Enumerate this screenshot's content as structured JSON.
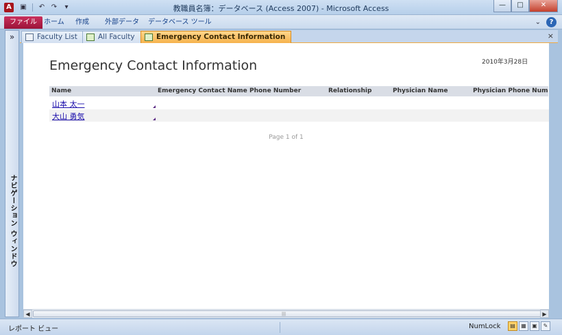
{
  "window": {
    "title": "教職員名簿：データベース (Access 2007) - Microsoft Access",
    "app_icon_letter": "A",
    "minimize": "—",
    "maximize": "□",
    "close": "✕"
  },
  "qat": {
    "save_icon": "▣",
    "undo_icon": "↶",
    "redo_icon": "↷",
    "customize_icon": "▾"
  },
  "ribbon": {
    "tabs": [
      "ファイル",
      "ホーム",
      "作成",
      "外部データ",
      "データベース ツール"
    ],
    "collapse_icon": "⌄",
    "help": "?"
  },
  "nav": {
    "toggle": "»",
    "label": "ナビゲーション ウィンドウ"
  },
  "doc_tabs": [
    {
      "label": "Faculty List"
    },
    {
      "label": "All Faculty"
    },
    {
      "label": "Emergency Contact Information"
    }
  ],
  "doc_close": "×",
  "report": {
    "date": "2010年3月28日",
    "title": "Emergency Contact Information",
    "columns": [
      "Name",
      "Emergency Contact Name",
      "Phone Number",
      "Relationship",
      "Physician Name",
      "Physician Phone Number"
    ],
    "rows": [
      {
        "name": "山本 太一"
      },
      {
        "name": "大山 勇気"
      }
    ],
    "page": "Page 1 of 1"
  },
  "scrollbar": {
    "left": "◀",
    "right": "▶",
    "grip": "|||"
  },
  "status": {
    "view_name": "レポート ビュー",
    "numlock": "NumLock",
    "view_icons": [
      "▤",
      "▦",
      "▣",
      "✎"
    ]
  },
  "colors": {
    "active_tab": "#f6b24c",
    "file_tab": "#b31f4c",
    "link": "#1a0dab"
  }
}
